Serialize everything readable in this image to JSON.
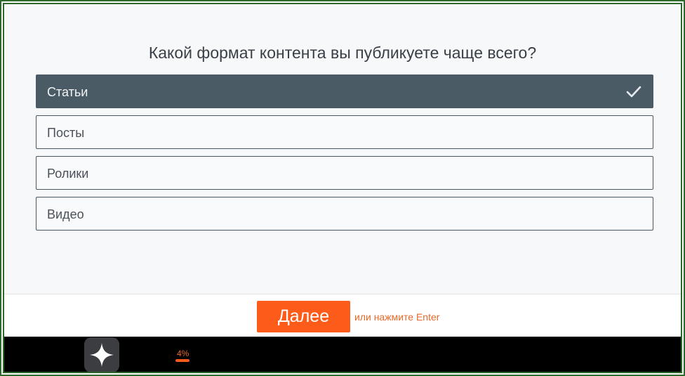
{
  "question": "Какой формат контента вы публикуете чаще всего?",
  "options": [
    {
      "label": "Статьи",
      "selected": true
    },
    {
      "label": "Посты",
      "selected": false
    },
    {
      "label": "Ролики",
      "selected": false
    },
    {
      "label": "Видео",
      "selected": false
    }
  ],
  "footer": {
    "next_label": "Далее",
    "enter_hint": "или нажмите Enter"
  },
  "progress": {
    "text": "4%",
    "value": 0.04
  },
  "icons": {
    "selected_check": "check-icon",
    "brand_logo": "sparkle-star-logo"
  },
  "colors": {
    "accent": "#fc5b1a",
    "selected_option": "#4a5b66",
    "frame": "#2f6b2f"
  }
}
